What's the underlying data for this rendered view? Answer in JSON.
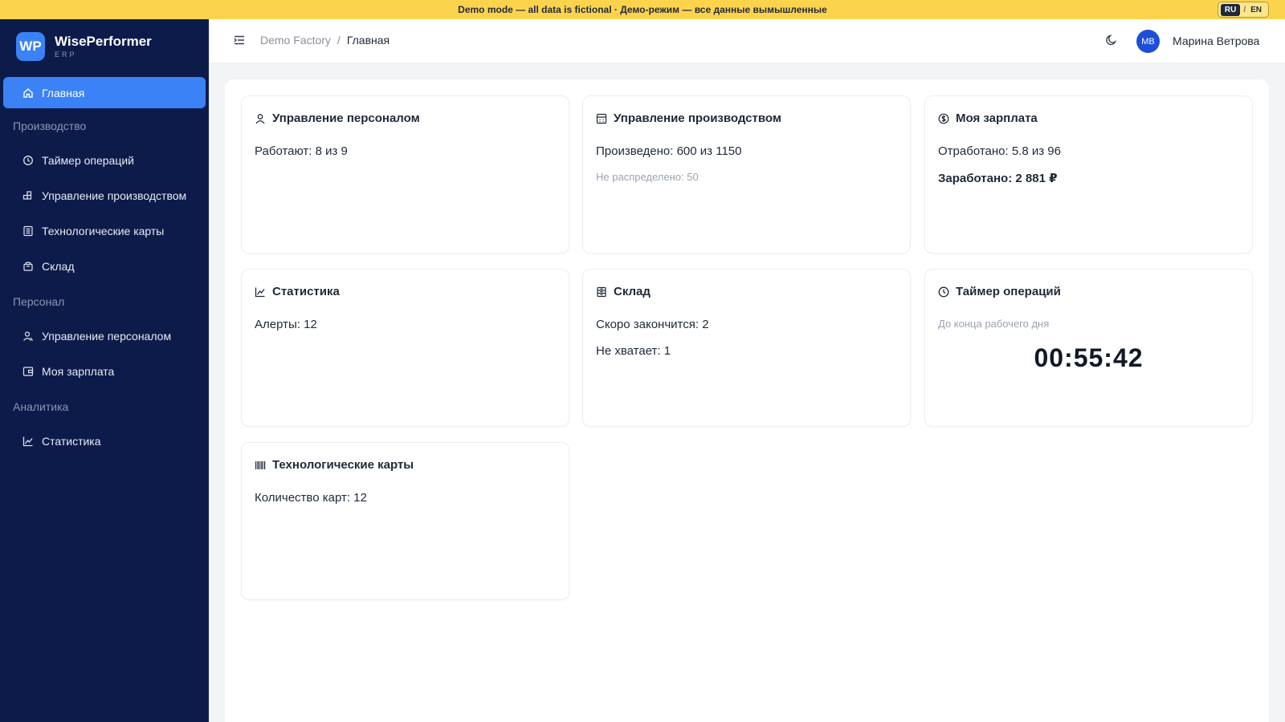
{
  "banner": {
    "text": "Demo mode — all data is fictional · Демо-режим — все данные вымышленные",
    "lang_ru": "RU",
    "lang_sep": "/",
    "lang_en": "EN"
  },
  "brand": {
    "logo": "WP",
    "name": "WisePerformer",
    "sub": "ERP"
  },
  "sidebar": {
    "active": {
      "label": "Главная",
      "icon": "home-icon"
    },
    "sections": [
      {
        "title": "Производство",
        "items": [
          {
            "label": "Таймер операций",
            "icon": "clock-icon"
          },
          {
            "label": "Управление производством",
            "icon": "cubes-icon"
          },
          {
            "label": "Технологические карты",
            "icon": "list-icon"
          },
          {
            "label": "Склад",
            "icon": "box-icon"
          }
        ]
      },
      {
        "title": "Персонал",
        "items": [
          {
            "label": "Управление персоналом",
            "icon": "users-icon"
          },
          {
            "label": "Моя зарплата",
            "icon": "wallet-icon"
          }
        ]
      },
      {
        "title": "Аналитика",
        "items": [
          {
            "label": "Статистика",
            "icon": "chart-icon"
          }
        ]
      }
    ]
  },
  "topbar": {
    "breadcrumb_root": "Demo Factory",
    "breadcrumb_sep": "/",
    "breadcrumb_current": "Главная",
    "avatar_initials": "МВ",
    "user_name": "Марина Ветрова"
  },
  "cards": {
    "personnel": {
      "title": "Управление персоналом",
      "line1": "Работают: 8 из 9"
    },
    "production": {
      "title": "Управление производством",
      "line1": "Произведено: 600 из 1150",
      "sub": "Не распределено: 50"
    },
    "salary": {
      "title": "Моя зарплата",
      "line1": "Отработано: 5.8 из 96",
      "line2": "Заработано: 2 881 ₽"
    },
    "stats": {
      "title": "Статистика",
      "line1": "Алерты: 12"
    },
    "warehouse": {
      "title": "Склад",
      "line1": "Скоро закончится: 2",
      "line2": "Не хватает: 1"
    },
    "timer": {
      "title": "Таймер операций",
      "sub": "До конца рабочего дня",
      "value": "00:55:42"
    },
    "techcards": {
      "title": "Технологические карты",
      "line1": "Количество карт: 12"
    }
  },
  "colors": {
    "sidebar_bg": "#0d1b4b",
    "accent": "#3b82f6",
    "banner_bg": "#fcd34d"
  }
}
